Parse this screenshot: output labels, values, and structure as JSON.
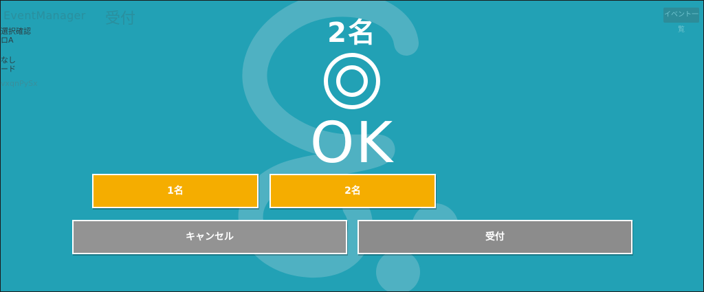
{
  "header": {
    "app_name": "EventManager",
    "page_title": "受付",
    "right_button": "イベント一覧"
  },
  "side_info": {
    "line1": "選択確認",
    "line2": "ロA",
    "line3": "なし",
    "line4": "ード",
    "line5": "vxqnPySx"
  },
  "result": {
    "count_label": "2名",
    "status_icon": "double-circle-icon",
    "status_text": "OK"
  },
  "buttons": {
    "one_person": "1名",
    "two_people": "2名",
    "cancel": "キャンセル",
    "accept": "受付"
  },
  "colors": {
    "background": "#22a1b5",
    "count_button": "#f5ad00",
    "gray_button": "#939393",
    "logo": "#4fb1c2"
  }
}
